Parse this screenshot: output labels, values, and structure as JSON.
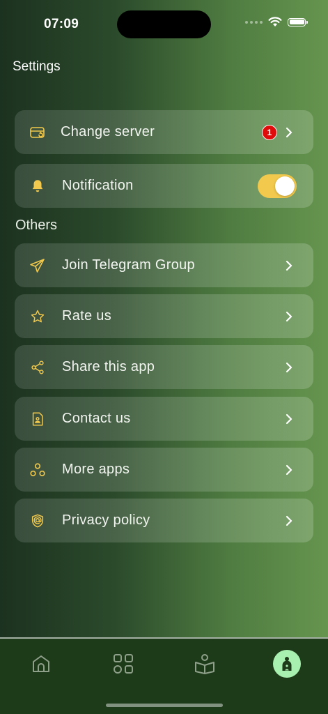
{
  "status_bar": {
    "time": "07:09"
  },
  "page": {
    "title": "Settings"
  },
  "top_items": [
    {
      "label": "Change server",
      "icon": "server-card-icon",
      "badge": "1"
    },
    {
      "label": "Notification",
      "icon": "bell-icon",
      "toggle_on": true
    }
  ],
  "others": {
    "title": "Others",
    "items": [
      {
        "label": "Join Telegram Group",
        "icon": "telegram-icon"
      },
      {
        "label": "Rate us",
        "icon": "star-icon"
      },
      {
        "label": "Share this app",
        "icon": "share-icon"
      },
      {
        "label": "Contact us",
        "icon": "contact-icon"
      },
      {
        "label": "More apps",
        "icon": "more-apps-icon"
      },
      {
        "label": "Privacy policy",
        "icon": "privacy-shield-icon"
      }
    ]
  },
  "tabbar": {
    "tabs": [
      {
        "icon": "home-icon",
        "active": false
      },
      {
        "icon": "grid-icon",
        "active": false
      },
      {
        "icon": "book-reader-icon",
        "active": false
      },
      {
        "icon": "profile-icon",
        "active": true
      }
    ]
  },
  "colors": {
    "accent": "#f2c94c",
    "badge": "#e00b0b",
    "active_tab": "#a8f0b0",
    "tabbar": "#1d3a19"
  }
}
